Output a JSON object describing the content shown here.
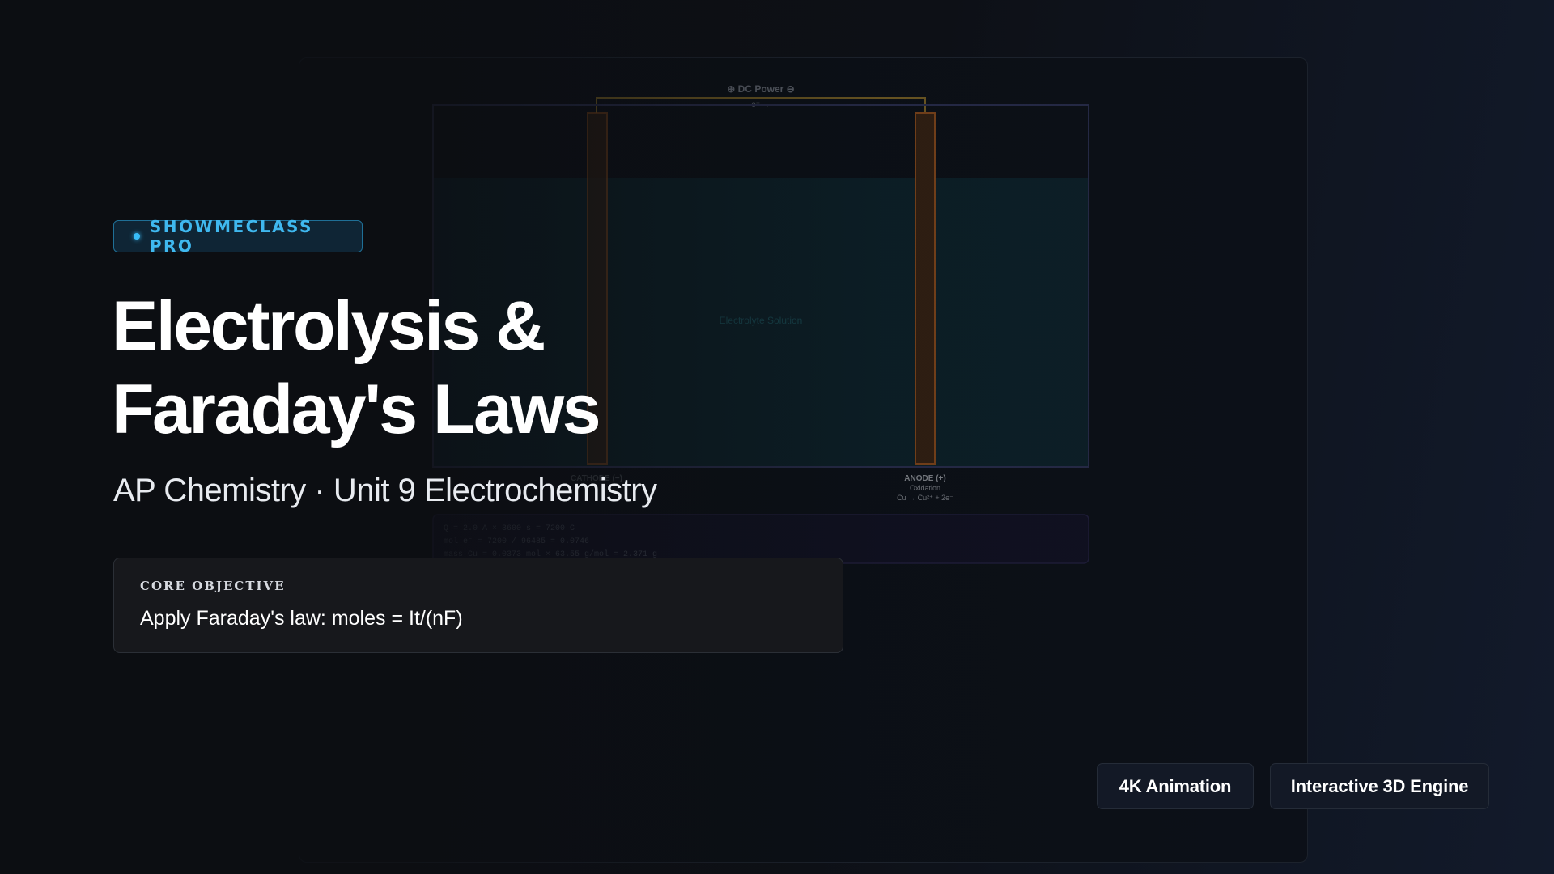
{
  "brand": {
    "badge_label": "SHOWMECLASS PRO"
  },
  "hero": {
    "title_line1": "Electrolysis &",
    "title_line2": "Faraday's Laws",
    "subtitle": "AP Chemistry · Unit 9 Electrochemistry"
  },
  "objective": {
    "label": "CORE OBJECTIVE",
    "text": "Apply Faraday's law: moles = It/(nF)"
  },
  "features": [
    {
      "label": "4K Animation"
    },
    {
      "label": "Interactive 3D Engine"
    }
  ],
  "simulation": {
    "power_label": "⊕ DC Power ⊖",
    "electron_label": "e⁻ →",
    "solution_label": "Electrolyte Solution",
    "cathode_label": "CATHODE (−)",
    "anode_label": "ANODE (+)",
    "anode_sub": "Oxidation",
    "anode_reaction": "Cu → Cu²⁺ + 2e⁻",
    "calc_lines": [
      "Q = 2.0 A × 3600 s = 7200 C",
      "mol e⁻ = 7200 / 96485 = 0.0746",
      "mass Cu = 0.0373 mol × 63.55 g/mol = 2.371 g"
    ]
  },
  "colors": {
    "accent": "#38bdf8",
    "electrode": "#c2641c",
    "solution": "#0f3a44",
    "background": "#0c0e12"
  }
}
